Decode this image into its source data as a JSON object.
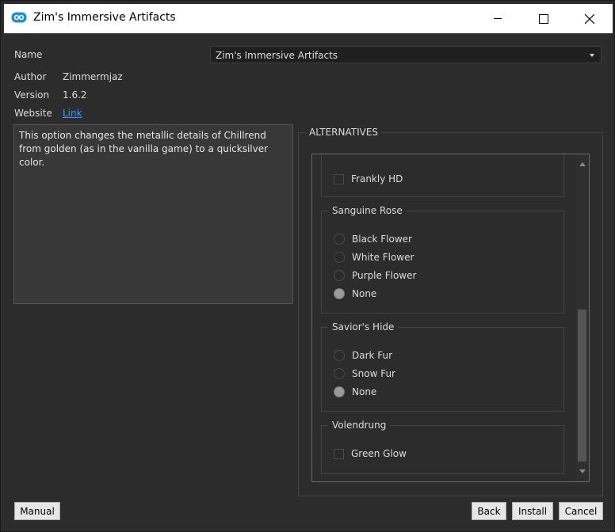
{
  "window": {
    "title": "Zim's Immersive Artifacts"
  },
  "fields": {
    "name_label": "Name",
    "name_value": "Zim's Immersive Artifacts",
    "author_label": "Author",
    "author_value": "Zimmermjaz",
    "version_label": "Version",
    "version_value": "1.6.2",
    "website_label": "Website",
    "website_link": "Link"
  },
  "description": "This option changes the metallic details of Chillrend from golden (as in the vanilla game) to a quicksilver color.",
  "alternatives": {
    "title": "ALTERNATIVES",
    "groups": [
      {
        "title": "",
        "options": [
          {
            "label": "Frankly HD",
            "type": "checkbox",
            "selected": false
          }
        ]
      },
      {
        "title": "Sanguine Rose",
        "options": [
          {
            "label": "Black Flower",
            "type": "radio",
            "selected": false
          },
          {
            "label": "White Flower",
            "type": "radio",
            "selected": false
          },
          {
            "label": "Purple Flower",
            "type": "radio",
            "selected": false
          },
          {
            "label": "None",
            "type": "radio",
            "selected": true
          }
        ]
      },
      {
        "title": "Savior's Hide",
        "options": [
          {
            "label": "Dark Fur",
            "type": "radio",
            "selected": false
          },
          {
            "label": "Snow Fur",
            "type": "radio",
            "selected": false
          },
          {
            "label": "None",
            "type": "radio",
            "selected": true
          }
        ]
      },
      {
        "title": "Volendrung",
        "options": [
          {
            "label": "Green Glow",
            "type": "checkbox",
            "selected": false
          }
        ]
      }
    ]
  },
  "buttons": {
    "manual": "Manual",
    "back": "Back",
    "install": "Install",
    "cancel": "Cancel"
  },
  "icons": {
    "app": "app-logo-icon",
    "minimize": "minimize-icon",
    "maximize": "maximize-icon",
    "close": "close-icon"
  },
  "colors": {
    "link": "#3d9bff",
    "background": "#2c2c2c"
  }
}
